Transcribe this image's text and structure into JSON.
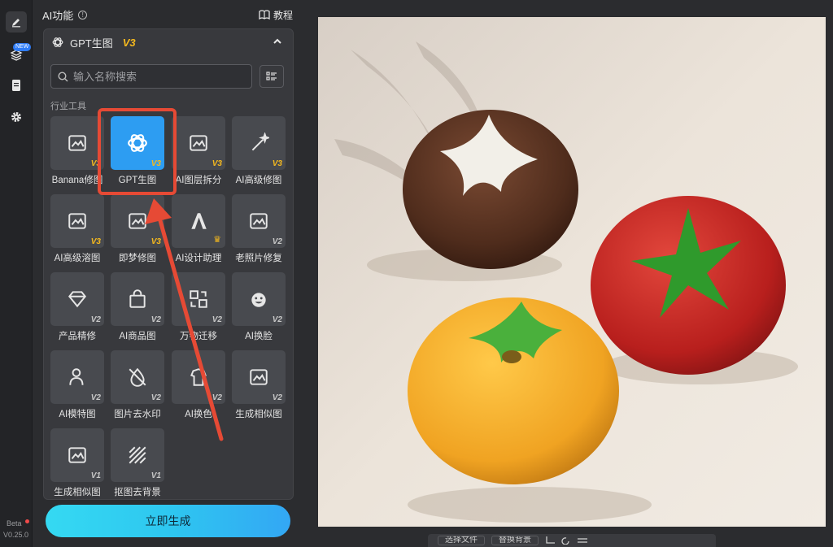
{
  "rail": {
    "new_badge": "NEW",
    "beta": "Beta",
    "version": "V0.25.0"
  },
  "panel": {
    "title": "AI功能",
    "tutorial": "教程"
  },
  "tool": {
    "name": "GPT生图",
    "version": "V3"
  },
  "search": {
    "placeholder": "输入名称搜索"
  },
  "section_label": "行业工具",
  "tiles": [
    {
      "label": "Banana修图",
      "version": "V3",
      "gold": true,
      "icon": "image-edit-icon"
    },
    {
      "label": "GPT生图",
      "version": "V3",
      "gold": true,
      "icon": "gpt-logo-icon",
      "selected": true
    },
    {
      "label": "AI图层拆分",
      "version": "V3",
      "gold": true,
      "icon": "layer-split-icon"
    },
    {
      "label": "AI高级修图",
      "version": "V3",
      "gold": true,
      "icon": "magic-wand-icon"
    },
    {
      "label": "AI高级溶图",
      "version": "V3",
      "gold": true,
      "icon": "image-blend-icon"
    },
    {
      "label": "即梦修图",
      "version": "V3",
      "gold": true,
      "icon": "dream-edit-icon"
    },
    {
      "label": "AI设计助理",
      "version": "",
      "gold": true,
      "icon": "design-assistant-icon",
      "crown": true
    },
    {
      "label": "老照片修复",
      "version": "V2",
      "gold": false,
      "icon": "photo-repair-icon"
    },
    {
      "label": "产品精修",
      "version": "V2",
      "gold": false,
      "icon": "diamond-icon"
    },
    {
      "label": "AI商品图",
      "version": "V2",
      "gold": false,
      "icon": "shopping-bag-icon"
    },
    {
      "label": "万物迁移",
      "version": "V2",
      "gold": false,
      "icon": "transfer-icon"
    },
    {
      "label": "AI换脸",
      "version": "V2",
      "gold": false,
      "icon": "face-swap-icon"
    },
    {
      "label": "AI模特图",
      "version": "V2",
      "gold": false,
      "icon": "model-icon"
    },
    {
      "label": "图片去水印",
      "version": "V2",
      "gold": false,
      "icon": "remove-watermark-icon"
    },
    {
      "label": "AI换色",
      "version": "V2",
      "gold": false,
      "icon": "recolor-icon"
    },
    {
      "label": "生成相似图",
      "version": "V2",
      "gold": false,
      "icon": "similar-image-icon"
    },
    {
      "label": "生成相似图",
      "version": "V1",
      "gold": false,
      "icon": "similar-image-icon"
    },
    {
      "label": "抠图去背景",
      "version": "V1",
      "gold": false,
      "icon": "remove-background-icon"
    }
  ],
  "generate_label": "立即生成",
  "bottombar": {
    "select_file": "选择文件",
    "replace_bg": "替换背景"
  },
  "colors": {
    "selected_tile": "#2d9df2",
    "highlight": "#e64a35",
    "version_gold": "#f5b91e"
  }
}
